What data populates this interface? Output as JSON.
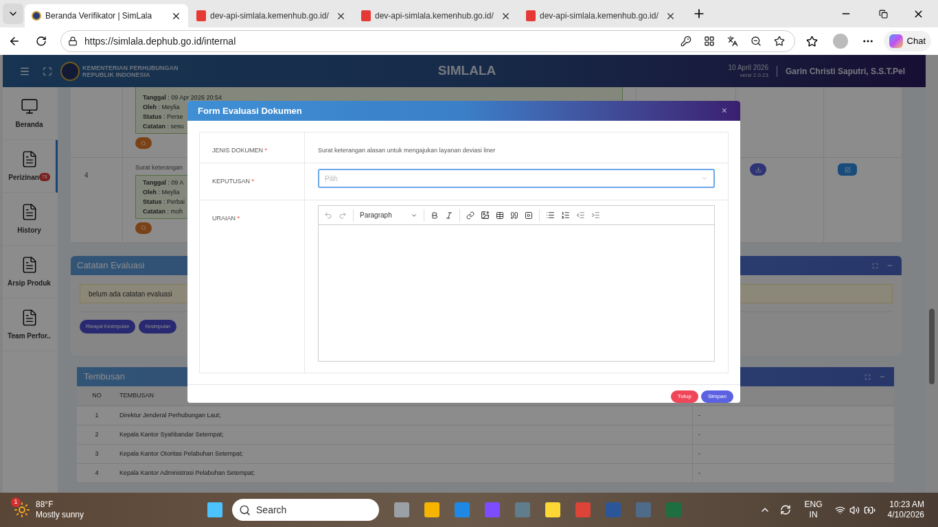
{
  "browser": {
    "tabs": [
      {
        "title": "Beranda Verifikator | SimLala",
        "kind": "page",
        "selected": true
      },
      {
        "title": "dev-api-simlala.kemenhub.go.id/",
        "kind": "pdf",
        "selected": false
      },
      {
        "title": "dev-api-simlala.kemenhub.go.id/",
        "kind": "pdf",
        "selected": false
      },
      {
        "title": "dev-api-simlala.kemenhub.go.id/",
        "kind": "pdf",
        "selected": false
      }
    ],
    "url": "https://simlala.dephub.go.id/internal",
    "chat": "Chat"
  },
  "header": {
    "org": [
      "KEMENTERIAN PERHUBUNGAN",
      "REPUBLIK INDONESIA"
    ],
    "title": "SIMLALA",
    "date": "10 April 2026",
    "version": "versi 2.0.23",
    "user": "Garin Christi Saputri, S.S.T.Pel"
  },
  "sidebar": [
    {
      "label": "Beranda",
      "selected": false
    },
    {
      "label": "Perizinan",
      "selected": true,
      "badge": "78"
    },
    {
      "label": "History",
      "selected": false
    },
    {
      "label": "Arsip Produk",
      "selected": false
    },
    {
      "label": "Team Perfor..",
      "selected": false
    }
  ],
  "documents": [
    {
      "log": [
        "**Tanggal** : 09 Apr 2026 20:54",
        "**Oleh** : Meylia",
        "**Status** : Perse",
        "**Catatan** : sesu"
      ]
    },
    {
      "no": "4",
      "title": "Surat keterangan",
      "log": [
        "**Tanggal** : 09 A",
        "**Oleh** : Meylia",
        "**Status** : Perbai",
        "**Catatan** : moh"
      ]
    }
  ],
  "evaluation_notes": {
    "title": "Catatan Evaluasi",
    "message": "belum ada catatan evaluasi",
    "buttons": [
      "Riwayat Kesimpulan",
      "Kesimpulan"
    ]
  },
  "tembusan": {
    "title": "Tembusan",
    "columns": [
      "NO",
      "TEMBUSAN"
    ],
    "rows": [
      {
        "no": "1",
        "name": "Direktur Jenderal Perhubungan Laut;",
        "column_3": "-"
      },
      {
        "no": "2",
        "name": "Kepala Kantor Syahbandar Setempat;",
        "column_3": "-"
      },
      {
        "no": "3",
        "name": "Kepala Kantor Otoritas Pelabuhan Setempat;",
        "column_3": "-"
      },
      {
        "no": "4",
        "name": "Kepala Kantor Administrasi Pelabuhan Setempat;",
        "column_3": "-"
      }
    ]
  },
  "modal": {
    "title": "Form Evaluasi Dokumen",
    "close": "×",
    "fields": [
      {
        "label": "JENIS DOKUMEN",
        "required_mark": "*",
        "kind": "text",
        "value": "Surat keterangan alasan untuk mengajukan layanan deviasi liner"
      },
      {
        "label": "KEPUTUSAN",
        "required_mark": "*",
        "kind": "select",
        "placeholder": "Pilih"
      },
      {
        "label": "URAIAN",
        "required_mark": "*",
        "kind": "editor",
        "block_style": "Paragraph"
      }
    ],
    "buttons": [
      {
        "label": "Tutup",
        "kind": "cancel"
      },
      {
        "label": "Simpan",
        "kind": "submit"
      }
    ]
  },
  "taskbar": {
    "weather": {
      "temp": "88°F",
      "text": "Mostly sunny",
      "badge": "1"
    },
    "search": "Search",
    "language": [
      "ENG",
      "IN"
    ],
    "time": "10:23 AM",
    "date": "4/10/2026"
  }
}
